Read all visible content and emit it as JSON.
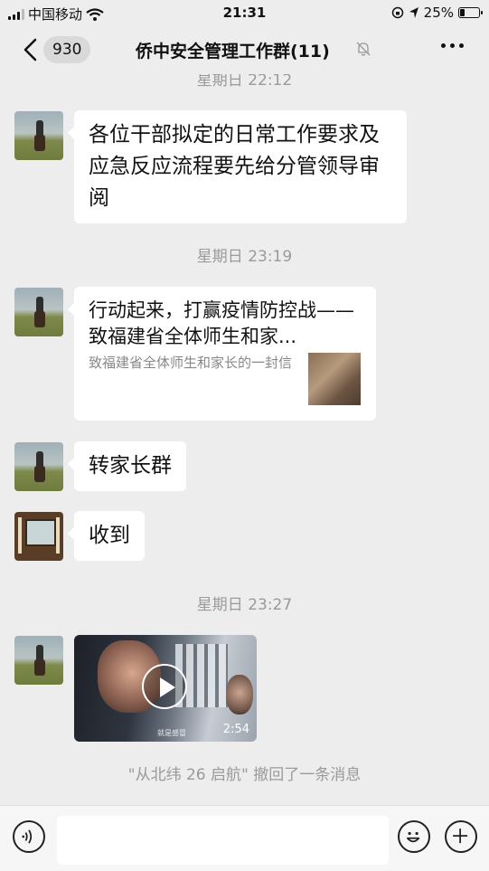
{
  "status_bar": {
    "carrier": "中国移动",
    "time": "21:31",
    "battery": "25%",
    "battery_level": 0.25
  },
  "nav": {
    "back_count": "930",
    "title": "侨中安全管理工作群(11)"
  },
  "messages": {
    "ts_partial": "星期日 22:12",
    "msg1": "各位干部拟定的日常工作要求及应急反应流程要先给分管领导审阅",
    "ts1": "星期日 23:19",
    "card": {
      "title": "行动起来，打赢疫情防控战——致福建省全体师生和家...",
      "desc": "致福建省全体师生和家长的一封信"
    },
    "msg2": "转家长群",
    "msg3": "收到",
    "ts2": "星期日 23:27",
    "video": {
      "duration": "2:54",
      "caption": "就是感冒"
    },
    "recall": "\"从北纬 26 启航\" 撤回了一条消息"
  },
  "input": {
    "placeholder": ""
  },
  "icons": {
    "voice": "voice-icon",
    "emoji": "emoji-icon",
    "plus": "plus-icon"
  }
}
